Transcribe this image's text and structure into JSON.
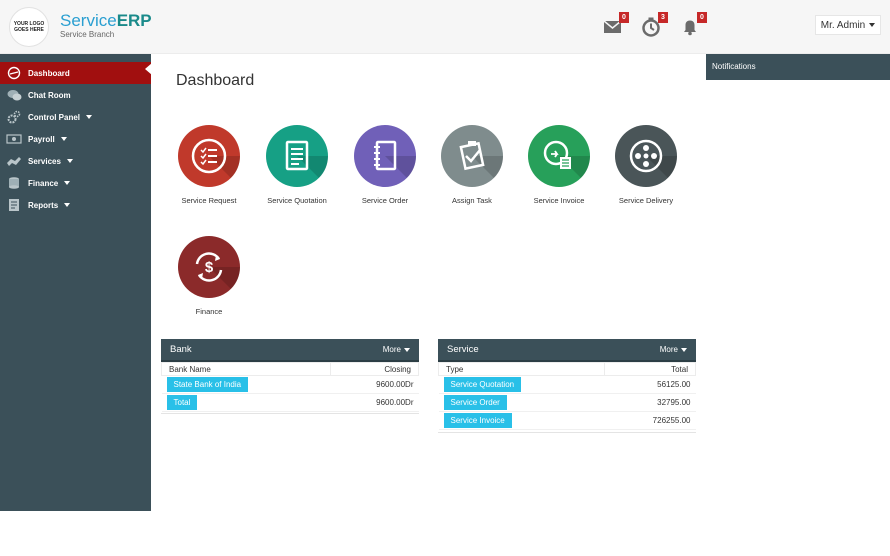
{
  "header": {
    "logo_line1": "YOUR LOGO",
    "logo_line2": "GOES HERE",
    "brand_service": "Service",
    "brand_erp": "ERP",
    "brand_sub": "Service Branch",
    "mail_count": "0",
    "clock_count": "3",
    "bell_count": "0",
    "admin_label": "Mr. Admin"
  },
  "sidebar": {
    "items": [
      {
        "label": "Dashboard",
        "icon": "dashboard-icon"
      },
      {
        "label": "Chat Room",
        "icon": "chat-icon"
      },
      {
        "label": "Control Panel",
        "icon": "gears-icon"
      },
      {
        "label": "Payroll",
        "icon": "payroll-icon"
      },
      {
        "label": "Services",
        "icon": "handshake-icon"
      },
      {
        "label": "Finance",
        "icon": "coins-icon"
      },
      {
        "label": "Reports",
        "icon": "report-icon"
      }
    ]
  },
  "notifications": {
    "title": "Notifications"
  },
  "main": {
    "title": "Dashboard",
    "tiles": [
      {
        "label": "Service Request",
        "color": "#c0392b"
      },
      {
        "label": "Service Quotation",
        "color": "#16a085"
      },
      {
        "label": "Service Order",
        "color": "#7060b8"
      },
      {
        "label": "Assign Task",
        "color": "#7f8c8d"
      },
      {
        "label": "Service Invoice",
        "color": "#27a05a"
      },
      {
        "label": "Service Delivery",
        "color": "#4a5558"
      },
      {
        "label": "Finance",
        "color": "#8b2a2a"
      }
    ]
  },
  "bank": {
    "title": "Bank",
    "more": "More",
    "col1": "Bank Name",
    "col2": "Closing",
    "rows": [
      {
        "name": "State Bank of India",
        "value": "9600.00Dr"
      },
      {
        "name": "Total",
        "value": "9600.00Dr"
      }
    ]
  },
  "service": {
    "title": "Service",
    "more": "More",
    "col1": "Type",
    "col2": "Total",
    "rows": [
      {
        "name": "Service Quotation",
        "value": "56125.00"
      },
      {
        "name": "Service Order",
        "value": "32795.00"
      },
      {
        "name": "Service Invoice",
        "value": "726255.00"
      }
    ]
  }
}
